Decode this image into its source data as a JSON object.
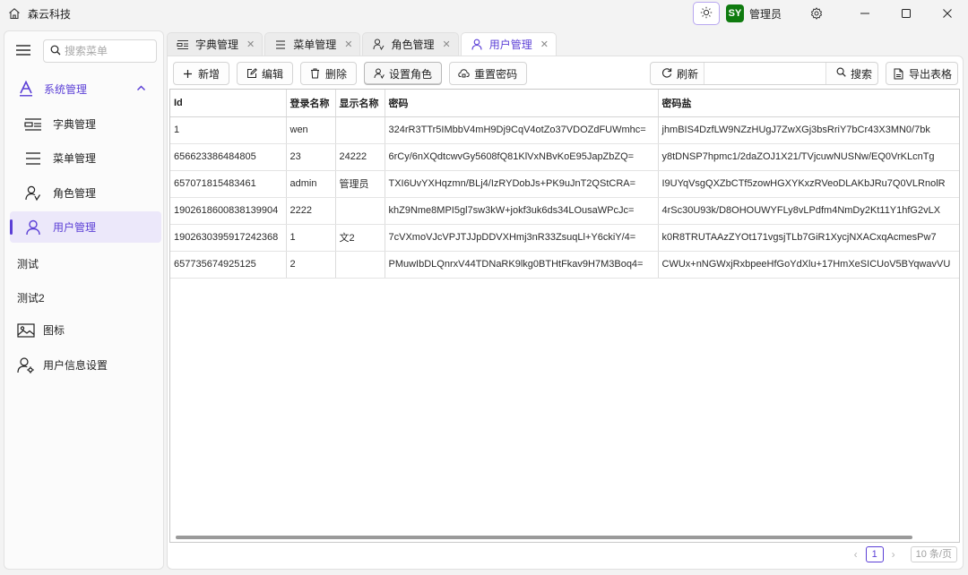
{
  "app": {
    "title": "森云科技"
  },
  "user": {
    "avatar_text": "SY",
    "name": "管理员"
  },
  "sidebar": {
    "search_placeholder": "搜索菜单",
    "group_label": "系统管理",
    "sub_items": [
      "字典管理",
      "菜单管理",
      "角色管理",
      "用户管理"
    ],
    "plain_items": [
      "测试",
      "测试2"
    ],
    "top_items": [
      "图标",
      "用户信息设置"
    ]
  },
  "tabs": [
    "字典管理",
    "菜单管理",
    "角色管理",
    "用户管理"
  ],
  "toolbar": {
    "add": "新增",
    "edit": "编辑",
    "delete": "删除",
    "set_role": "设置角色",
    "reset_password": "重置密码",
    "refresh": "刷新",
    "search": "搜索",
    "export": "导出表格",
    "search_value": ""
  },
  "table": {
    "columns": [
      "Id",
      "登录名称",
      "显示名称",
      "密码",
      "密码盐"
    ],
    "rows": [
      [
        "1",
        "wen",
        "",
        "324rR3TTr5IMbbV4mH9Dj9CqV4otZo37VDOZdFUWmhc=",
        "jhmBIS4DzfLW9NZzHUgJ7ZwXGj3bsRriY7bCr43X3MN0/7bk"
      ],
      [
        "656623386484805",
        "23",
        "24222",
        "6rCy/6nXQdtcwvGy5608fQ81KlVxNBvKoE95JapZbZQ=",
        "y8tDNSP7hpmc1/2daZOJ1X21/TVjcuwNUSNw/EQ0VrKLcnTg"
      ],
      [
        "657071815483461",
        "admin",
        "管理员",
        "TXI6UvYXHqzmn/BLj4/IzRYDobJs+PK9uJnT2QStCRA=",
        "I9UYqVsgQXZbCTf5zowHGXYKxzRVeoDLAKbJRu7Q0VLRnolR"
      ],
      [
        "1902618600838139904",
        "2222",
        "",
        "khZ9Nme8MPI5gl7sw3kW+jokf3uk6ds34LOusaWPcJc=",
        "4rSc30U93k/D8OHOUWYFLy8vLPdfm4NmDy2Kt11Y1hfG2vLX"
      ],
      [
        "1902630395917242368",
        "1",
        "文2",
        "7cVXmoVJcVPJTJJpDDVXHmj3nR33ZsuqLl+Y6ckiY/4=",
        "k0R8TRUTAAzZYOt171vgsjTLb7GiR1XycjNXACxqAcmesPw7"
      ],
      [
        "657735674925125",
        "2",
        "",
        "PMuwIbDLQnrxV44TDNaRK9lkg0BTHtFkav9H7M3Boq4=",
        "CWUx+nNGWxjRxbpeeHfGoYdXlu+17HmXeSICUoV5BYqwavVU"
      ]
    ]
  },
  "pager": {
    "prev": "‹",
    "current": "1",
    "next": "›",
    "page_size": "10 条/页"
  }
}
